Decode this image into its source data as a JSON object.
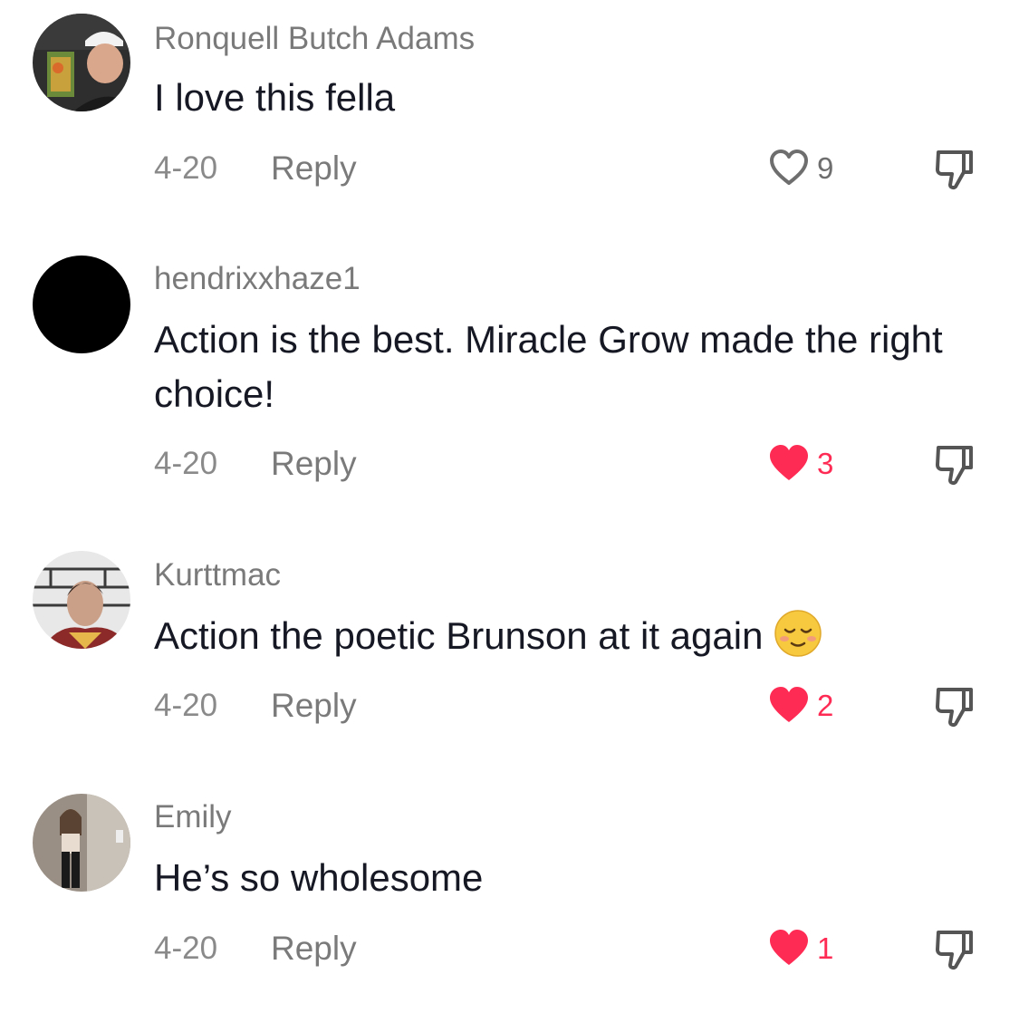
{
  "comments": [
    {
      "username": "Ronquell Butch Adams",
      "text": "I love this fella",
      "date": "4-20",
      "reply_label": "Reply",
      "likes": "9",
      "liked": false
    },
    {
      "username": "hendrixxhaze1",
      "text": "Action is the best. Miracle Grow made the right choice!",
      "date": "4-20",
      "reply_label": "Reply",
      "likes": "3",
      "liked": true
    },
    {
      "username": "Kurttmac",
      "text": "Action the poetic Brunson at it again",
      "emoji": "relieved-face-emoji",
      "date": "4-20",
      "reply_label": "Reply",
      "likes": "2",
      "liked": true
    },
    {
      "username": "Emily",
      "text": "He’s so wholesome",
      "date": "4-20",
      "reply_label": "Reply",
      "likes": "1",
      "liked": true
    }
  ],
  "icons": {
    "like": "heart-icon",
    "dislike": "thumbs-down-icon"
  },
  "colors": {
    "liked": "#fe2c55",
    "username": "#7a7a7a",
    "text": "#161823",
    "meta": "#8a8a8a"
  }
}
